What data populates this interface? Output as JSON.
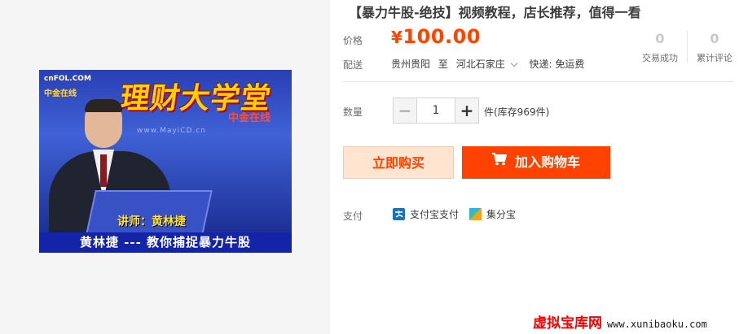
{
  "product": {
    "title": "【暴力牛股-绝技】视频教程，店长推荐，值得一看",
    "video": {
      "logo_top": "cnFOL.COM",
      "logo_bottom": "中金在线",
      "banner_title": "理财大学堂",
      "banner_sub": "中金在线",
      "url": "www.MayiCD.cn",
      "speaker": "讲师：黄林捷",
      "caption": "黄林捷 --- 教你捕捉暴力牛股"
    }
  },
  "price": {
    "label": "价格",
    "currency": "¥",
    "value": "100.00",
    "color": "#ff4400"
  },
  "shipping": {
    "label": "配送",
    "from": "贵州贵阳",
    "to_word": "至",
    "to": "河北石家庄",
    "method": "快递: 免运费"
  },
  "stats": {
    "transactions": {
      "value": "0",
      "label": "交易成功"
    },
    "reviews": {
      "value": "0",
      "label": "累计评论"
    }
  },
  "quantity": {
    "label": "数量",
    "value": "1",
    "minus": "−",
    "plus": "+",
    "stock_text": "件(库存969件)"
  },
  "actions": {
    "buy_now": "立即购买",
    "add_to_cart": "加入购物车"
  },
  "payment": {
    "label": "支付",
    "methods": [
      {
        "name": "支付宝支付",
        "icon": "alipay-icon"
      },
      {
        "name": "集分宝",
        "icon": "jifenbao-icon"
      }
    ]
  },
  "watermark": {
    "name": "虚拟宝库网",
    "url": "www.xunibaoku.com"
  }
}
